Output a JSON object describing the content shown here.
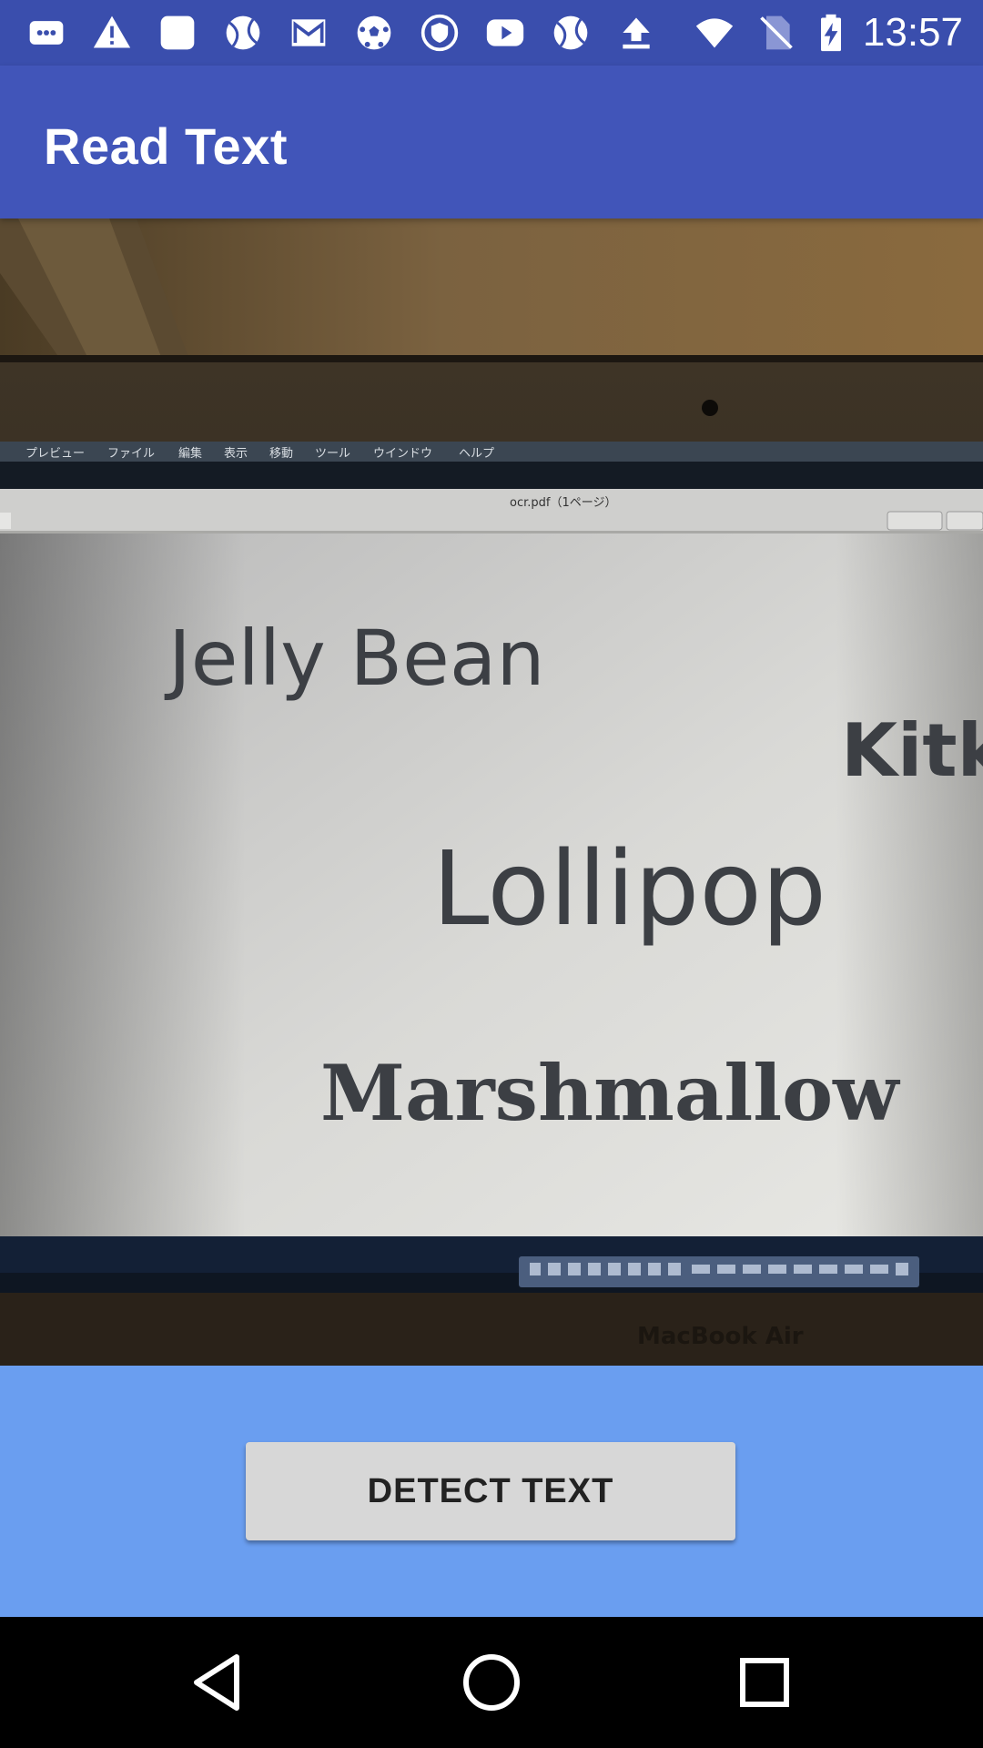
{
  "status_bar": {
    "time": "13:57",
    "left_icons": [
      "message-icon",
      "warning-icon",
      "notification-icon",
      "sports-ball-icon",
      "gmail-icon",
      "soccer-ball-icon",
      "vpn-shield-icon",
      "youtube-icon",
      "sports-ball-icon",
      "upload-icon"
    ],
    "right_icons": [
      "wifi-icon",
      "no-sim-icon",
      "battery-charging-icon"
    ]
  },
  "app_bar": {
    "title": "Read Text"
  },
  "photo": {
    "menu_items": [
      "プレビュー",
      "ファイル",
      "編集",
      "表示",
      "移動",
      "ツール",
      "ウインドウ",
      "ヘルプ"
    ],
    "window_title": "ocr.pdf（1ページ）",
    "words": [
      "Jelly Bean",
      "Kitk",
      "Lollipop",
      "Marshmallow"
    ],
    "brand": "MacBook Air"
  },
  "actions": {
    "detect_label": "DETECT TEXT"
  },
  "nav_bar": {
    "buttons": [
      "back-icon",
      "home-icon",
      "recents-icon"
    ]
  },
  "colors": {
    "status_bar": "#3a4ead",
    "app_bar": "#4155b9",
    "panel": "#6a9ef0",
    "button": "#d7d7d7"
  }
}
